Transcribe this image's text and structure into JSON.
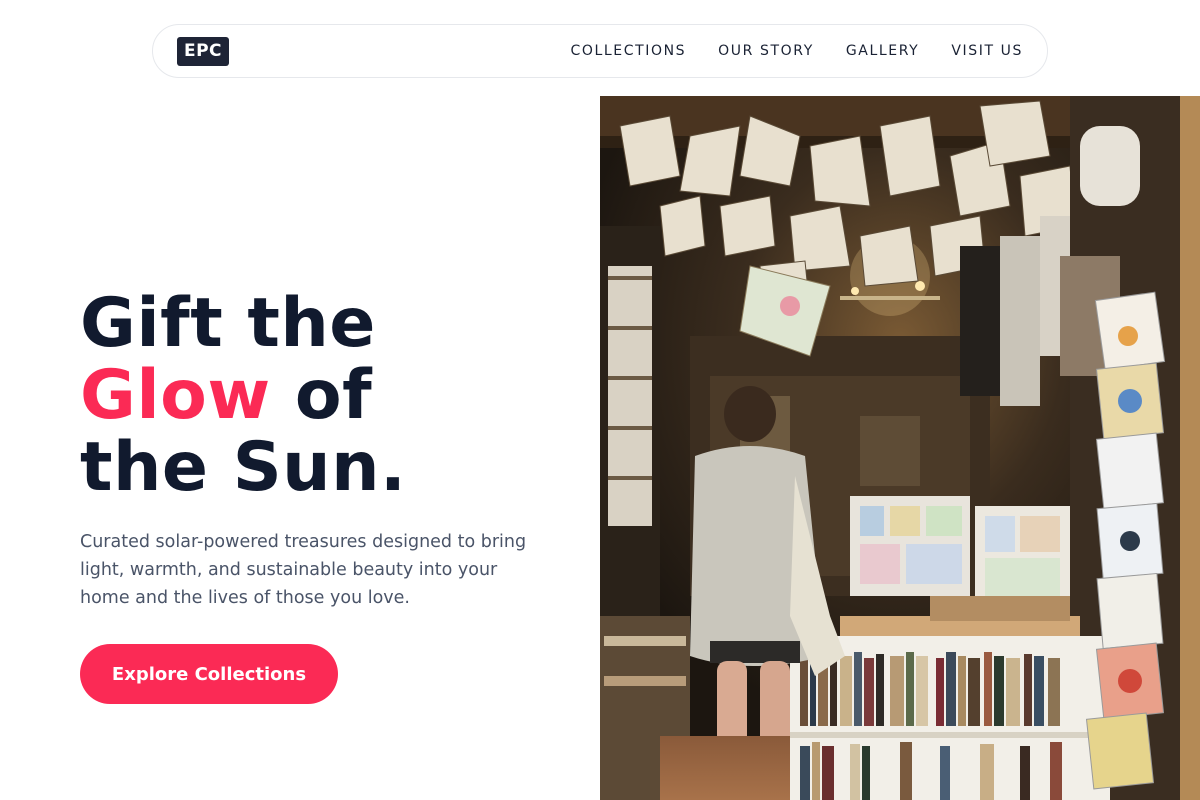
{
  "brand": {
    "logo_text": "EPC"
  },
  "nav": {
    "items": [
      {
        "label": "COLLECTIONS"
      },
      {
        "label": "OUR STORY"
      },
      {
        "label": "GALLERY"
      },
      {
        "label": "VISIT US"
      }
    ]
  },
  "hero": {
    "title_line1": "Gift the",
    "title_accent": "Glow",
    "title_line2_rest": " of",
    "title_line3": "the Sun.",
    "subtitle": "Curated solar-powered treasures designed to bring light, warmth, and sustainable beauty into your home and the lives of those you love.",
    "cta_label": "Explore Collections"
  },
  "colors": {
    "accent": "#fb2a55",
    "heading": "#111a2e",
    "body_text": "#4a5468",
    "logo_bg": "#1e2436"
  }
}
